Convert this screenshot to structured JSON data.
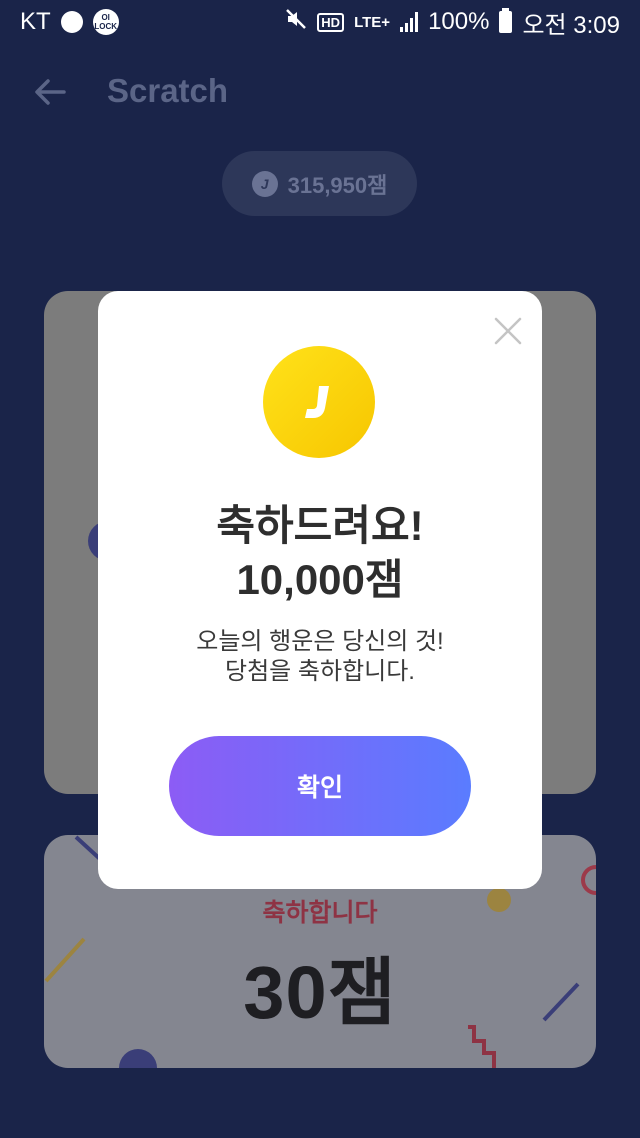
{
  "status_bar": {
    "carrier": "KT",
    "lock_app_label": "OI LOCK",
    "hd_badge": "HD",
    "network": "LTE+",
    "battery": "100%",
    "time": "오전 3:09"
  },
  "header": {
    "title": "Scratch"
  },
  "points": {
    "coin_glyph": "J",
    "balance": "315,950잼"
  },
  "ticket": {
    "subtitle": "축하합니다",
    "amount": "30잼"
  },
  "dialog": {
    "title_line1": "축하드려요!",
    "title_line2": "10,000잼",
    "desc_line1": "오늘의 행운은 당신의 것!",
    "desc_line2": "당첨을 축하합니다.",
    "confirm_label": "확인"
  },
  "colors": {
    "background": "#1a2449",
    "coin": "#ffd400",
    "button_start": "#8c5cf5",
    "button_end": "#5a7cff"
  }
}
